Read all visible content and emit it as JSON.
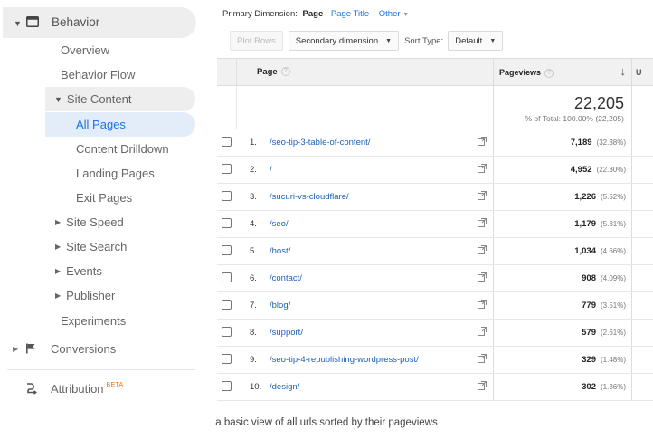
{
  "sidebar": {
    "behavior_label": "Behavior",
    "items": {
      "overview": "Overview",
      "behavior_flow": "Behavior Flow",
      "site_content": "Site Content",
      "all_pages": "All Pages",
      "content_drilldown": "Content Drilldown",
      "landing_pages": "Landing Pages",
      "exit_pages": "Exit Pages",
      "site_speed": "Site Speed",
      "site_search": "Site Search",
      "events": "Events",
      "publisher": "Publisher",
      "experiments": "Experiments"
    },
    "conversions_label": "Conversions",
    "attribution_label": "Attribution",
    "attribution_badge": "BETA"
  },
  "dimension_bar": {
    "label": "Primary Dimension:",
    "selected": "Page",
    "links": [
      "Page Title",
      "Other"
    ]
  },
  "toolbar": {
    "plot_rows": "Plot Rows",
    "secondary_dimension": "Secondary dimension",
    "sort_type_label": "Sort Type:",
    "sort_type_value": "Default"
  },
  "table": {
    "headers": {
      "page": "Page",
      "pageviews": "Pageviews",
      "next_col": "U"
    },
    "totals": {
      "pageviews": "22,205",
      "percent_of_total": "% of Total: 100.00% (22,205)"
    },
    "rows": [
      {
        "num": "1.",
        "url": "/seo-tip-3-table-of-content/",
        "pageviews": "7,189",
        "pct": "(32.38%)"
      },
      {
        "num": "2.",
        "url": "/",
        "pageviews": "4,952",
        "pct": "(22.30%)"
      },
      {
        "num": "3.",
        "url": "/sucuri-vs-cloudflare/",
        "pageviews": "1,226",
        "pct": "(5.52%)"
      },
      {
        "num": "4.",
        "url": "/seo/",
        "pageviews": "1,179",
        "pct": "(5.31%)"
      },
      {
        "num": "5.",
        "url": "/host/",
        "pageviews": "1,034",
        "pct": "(4.66%)"
      },
      {
        "num": "6.",
        "url": "/contact/",
        "pageviews": "908",
        "pct": "(4.09%)"
      },
      {
        "num": "7.",
        "url": "/blog/",
        "pageviews": "779",
        "pct": "(3.51%)"
      },
      {
        "num": "8.",
        "url": "/support/",
        "pageviews": "579",
        "pct": "(2.61%)"
      },
      {
        "num": "9.",
        "url": "/seo-tip-4-republishing-wordpress-post/",
        "pageviews": "329",
        "pct": "(1.48%)"
      },
      {
        "num": "10.",
        "url": "/design/",
        "pageviews": "302",
        "pct": "(1.36%)"
      }
    ]
  },
  "caption": "a basic view of all urls sorted by their pageviews",
  "colors": {
    "link": "#1a62b8",
    "active_bg": "#e3ecf9",
    "active_text": "#1a73e8",
    "beta": "#e8710a"
  },
  "icons": {
    "behavior": "window-icon",
    "conversions": "flag-icon",
    "attribution": "path-icon",
    "external": "open-in-new-icon",
    "sort": "arrow-down-icon"
  }
}
